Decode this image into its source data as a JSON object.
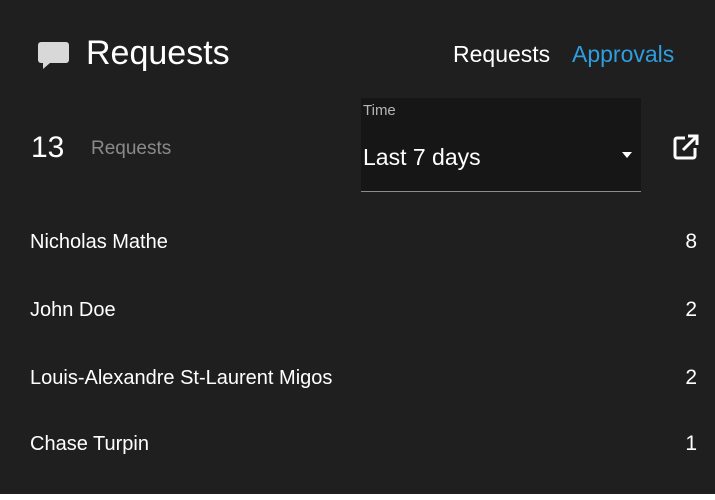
{
  "widget": {
    "title": "Requests",
    "tabs": [
      {
        "label": "Requests",
        "active": true
      },
      {
        "label": "Approvals",
        "active": false
      }
    ]
  },
  "summary": {
    "count": "13",
    "label": "Requests"
  },
  "time_filter": {
    "label": "Time",
    "value": "Last 7 days"
  },
  "rows": [
    {
      "name": "Nicholas Mathe",
      "count": "8"
    },
    {
      "name": "John Doe",
      "count": "2"
    },
    {
      "name": "Louis-Alexandre St-Laurent Migos",
      "count": "2"
    },
    {
      "name": "Chase Turpin",
      "count": "1"
    }
  ],
  "colors": {
    "background": "#1f1f1f",
    "accent": "#2f9ee0",
    "muted_text": "#8a8a8a"
  },
  "icons": {
    "header": "chat-bubble-icon",
    "select": "caret-down-icon",
    "open": "open-in-new-icon"
  }
}
